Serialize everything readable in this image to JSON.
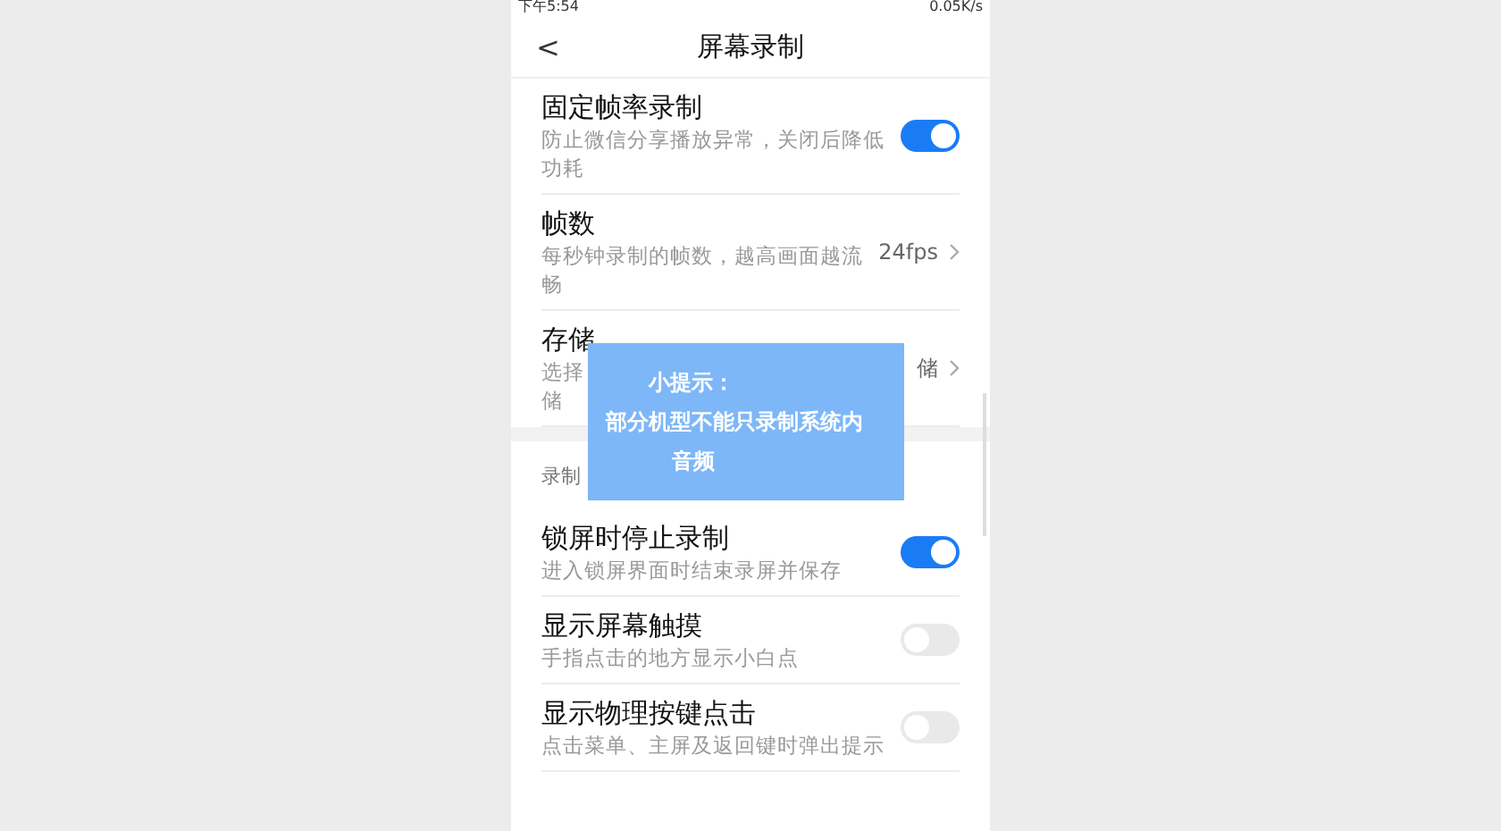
{
  "status_bar": {
    "time": "下午5:54",
    "speed": "0.05K/s"
  },
  "header": {
    "back": "<",
    "title": "屏幕录制"
  },
  "items": [
    {
      "kind": "toggle",
      "title": "固定帧率录制",
      "subtitle": "防止微信分享播放异常，关闭后降低功耗",
      "on": true
    },
    {
      "kind": "value",
      "title": "帧数",
      "subtitle": "每秒钟录制的帧数，越高画面越流畅",
      "value": "24fps"
    },
    {
      "kind": "value",
      "title": "存储",
      "subtitle": "选择",
      "subtitle2": "储",
      "value": "储"
    },
    {
      "kind": "section",
      "title": "录制"
    },
    {
      "kind": "toggle",
      "title": "锁屏时停止录制",
      "subtitle": "进入锁屏界面时结束录屏并保存",
      "on": true
    },
    {
      "kind": "toggle",
      "title": "显示屏幕触摸",
      "subtitle": "手指点击的地方显示小白点",
      "on": false
    },
    {
      "kind": "toggle",
      "title": "显示物理按键点击",
      "subtitle": "点击菜单、主屏及返回键时弹出提示",
      "on": false
    }
  ],
  "tip": {
    "title": "小提示：",
    "lines": [
      "部分机型不能只录制系统内",
      "音频"
    ]
  }
}
